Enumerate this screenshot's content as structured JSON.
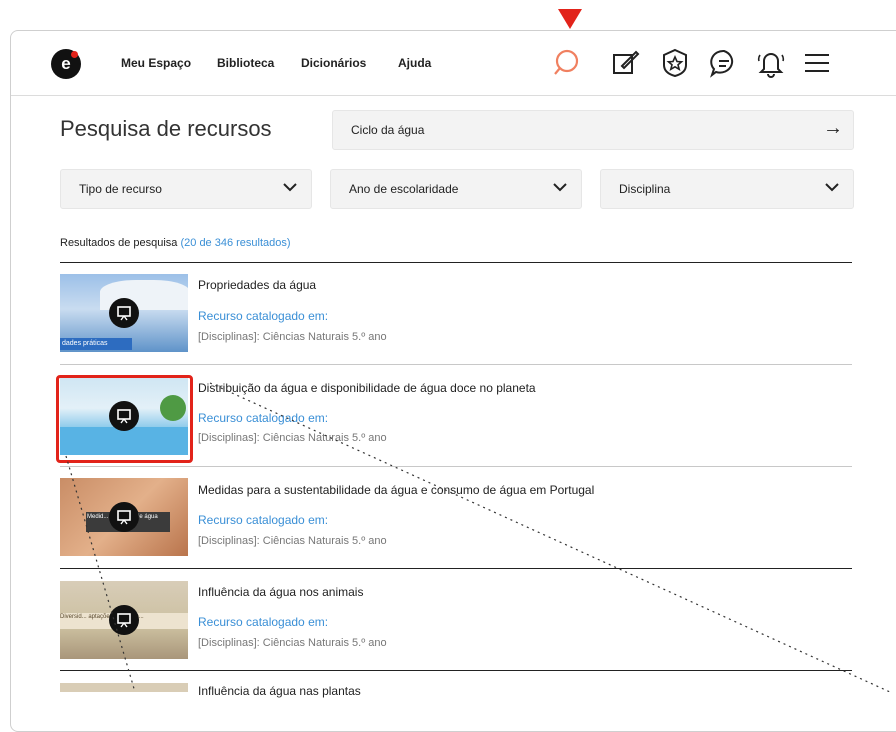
{
  "header": {
    "logo_text": "e",
    "nav": [
      "Meu Espaço",
      "Biblioteca",
      "Dicionários",
      "Ajuda"
    ],
    "icons": [
      "search-icon",
      "edit-icon",
      "badge-star-icon",
      "chat-icon",
      "bell-icon",
      "menu-icon"
    ],
    "accent_color": "#e2231a",
    "search_color": "#f08060"
  },
  "page": {
    "title": "Pesquisa de recursos",
    "search_value": "Ciclo da água",
    "search_submit": "→"
  },
  "filters": [
    {
      "label": "Tipo de recurso"
    },
    {
      "label": "Ano de escolaridade"
    },
    {
      "label": "Disciplina"
    }
  ],
  "results": {
    "label": "Resultados de pesquisa",
    "count_text": "(20 de 346 resultados)",
    "items": [
      {
        "title": "Propriedades da água",
        "link": "Recurso catalogado em:",
        "meta": "[Disciplinas]: Ciências Naturais 5.º ano",
        "thumb_caption": "dades práticas"
      },
      {
        "title": "Distribuição da água e disponibilidade de água doce no planeta",
        "link": "Recurso catalogado em:",
        "meta": "[Disciplinas]: Ciências Naturais 5.º ano",
        "thumb_caption": ""
      },
      {
        "title": "Medidas para a sustentabilidade da água e consumo de água em Portugal",
        "link": "Recurso catalogado em:",
        "meta": "[Disciplinas]: Ciências Naturais 5.º ano",
        "thumb_caption": "Medid... sustent... de água"
      },
      {
        "title": "Influência da água nos animais",
        "link": "Recurso catalogado em:",
        "meta": "[Disciplinas]: Ciências Naturais 5.º ano",
        "thumb_caption": "Diversid... aptações dos anim..."
      },
      {
        "title": "Influência da água nas plantas",
        "link": "",
        "meta": "",
        "thumb_caption": ""
      }
    ]
  }
}
